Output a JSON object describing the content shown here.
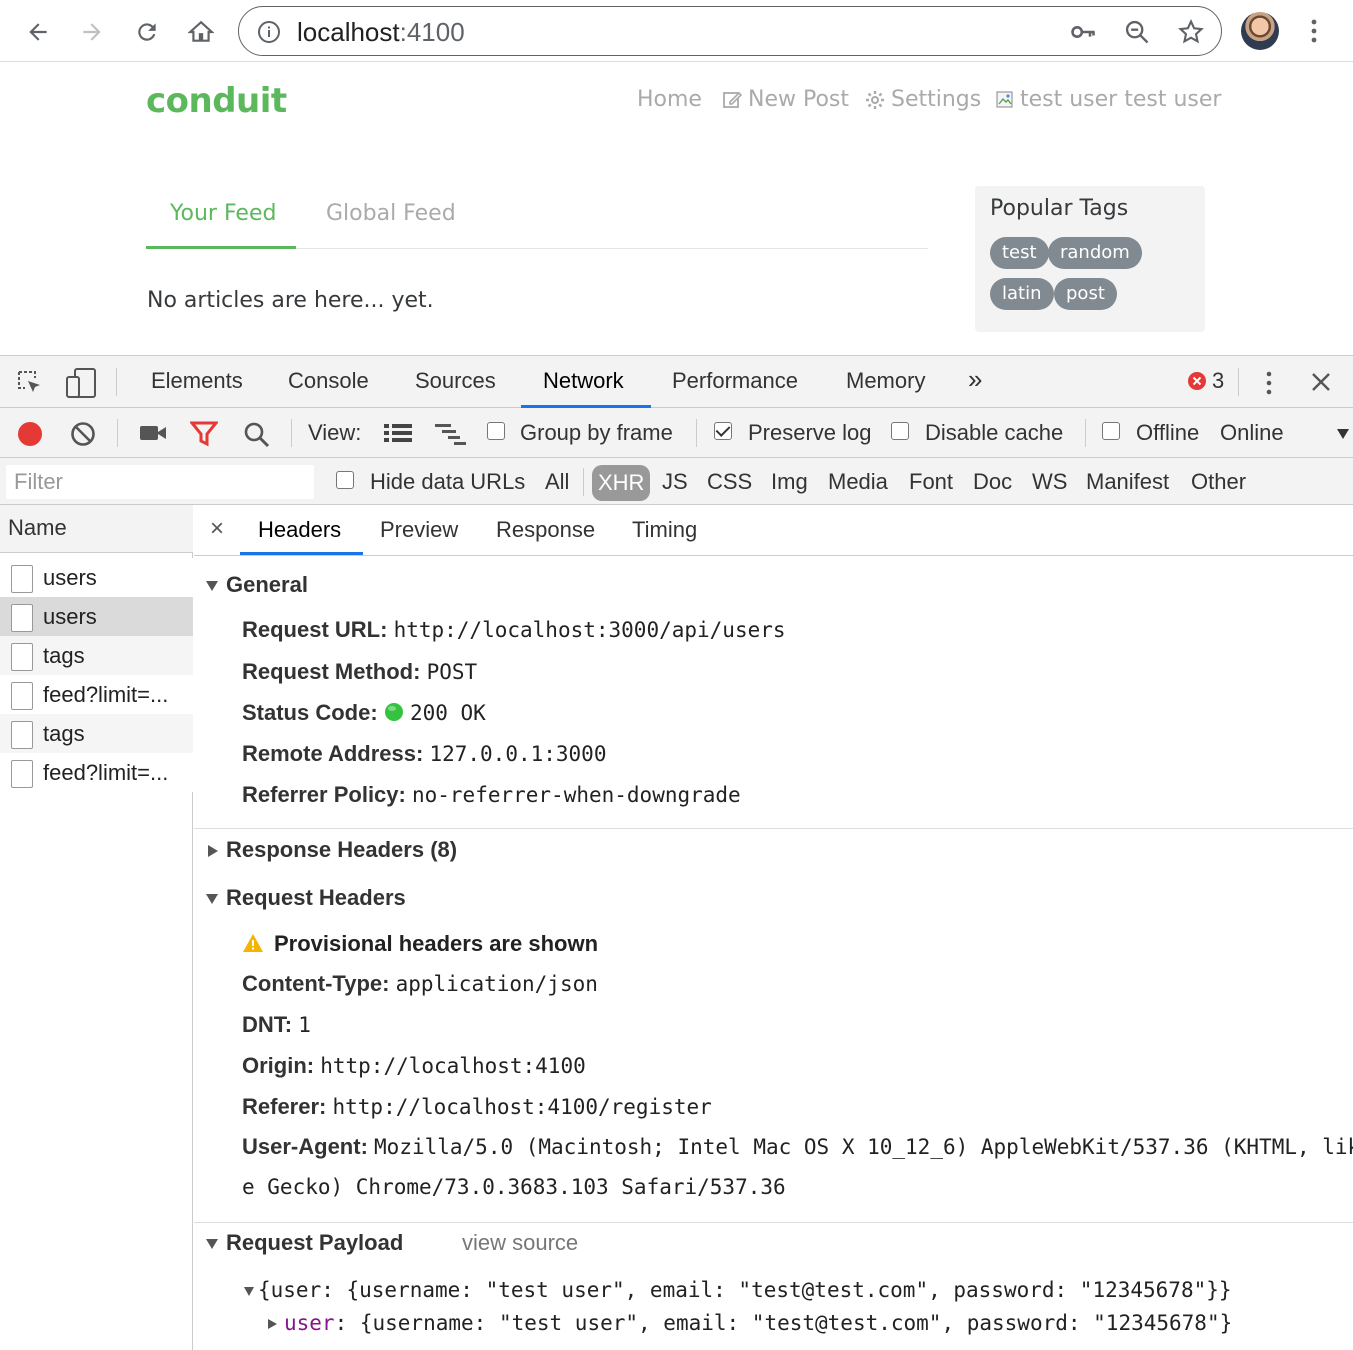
{
  "browser": {
    "url_host": "localhost",
    "url_port": ":4100"
  },
  "app": {
    "brand": "conduit",
    "nav": {
      "home": "Home",
      "new_post": "New Post",
      "settings": "Settings",
      "profile": "test user test user"
    },
    "feed_tabs": [
      "Your Feed",
      "Global Feed"
    ],
    "empty_message": "No articles are here... yet.",
    "popular_tags": {
      "title": "Popular Tags",
      "tags": [
        "test",
        "random",
        "latin",
        "post"
      ]
    }
  },
  "devtools": {
    "tabs": [
      "Elements",
      "Console",
      "Sources",
      "Network",
      "Performance",
      "Memory"
    ],
    "active_tab": "Network",
    "more_tabs": "»",
    "error_count": "3",
    "toolbar": {
      "view_label": "View:",
      "group_by_frame": "Group by frame",
      "preserve_log": "Preserve log",
      "disable_cache": "Disable cache",
      "offline": "Offline",
      "throttling": "Online"
    },
    "filter": {
      "placeholder": "Filter",
      "hide_data_urls": "Hide data URLs",
      "types": [
        "All",
        "XHR",
        "JS",
        "CSS",
        "Img",
        "Media",
        "Font",
        "Doc",
        "WS",
        "Manifest",
        "Other"
      ],
      "active_type": "XHR"
    },
    "requests": {
      "header": "Name",
      "items": [
        "users",
        "users",
        "tags",
        "feed?limit=...",
        "tags",
        "feed?limit=..."
      ]
    },
    "detail": {
      "close": "×",
      "tabs": [
        "Headers",
        "Preview",
        "Response",
        "Timing"
      ],
      "general": {
        "title": "General",
        "request_url_key": "Request URL:",
        "request_url": "http://localhost:3000/api/users",
        "method_key": "Request Method:",
        "method": "POST",
        "status_key": "Status Code:",
        "status": "200 OK",
        "remote_key": "Remote Address:",
        "remote": "127.0.0.1:3000",
        "referrer_key": "Referrer Policy:",
        "referrer": "no-referrer-when-downgrade"
      },
      "response_headers_title": "Response Headers (8)",
      "request_headers": {
        "title": "Request Headers",
        "warning": "Provisional headers are shown",
        "content_type_key": "Content-Type:",
        "content_type": "application/json",
        "dnt_key": "DNT:",
        "dnt": "1",
        "origin_key": "Origin:",
        "origin": "http://localhost:4100",
        "referer_key": "Referer:",
        "referer": "http://localhost:4100/register",
        "ua_key": "User-Agent:",
        "ua_line1": "Mozilla/5.0 (Macintosh; Intel Mac OS X 10_12_6) AppleWebKit/537.36 (KHTML, lik",
        "ua_line2": "e Gecko) Chrome/73.0.3683.103 Safari/537.36"
      },
      "payload": {
        "title": "Request Payload",
        "view_source": "view source",
        "root": "{user: {username: \"test user\", email: \"test@test.com\", password: \"12345678\"}}",
        "child_key": "user",
        "child_value": ": {username: \"test user\", email: \"test@test.com\", password: \"12345678\"}"
      }
    }
  },
  "colors": {
    "brand_green": "#5cb85c",
    "devtools_accent": "#1a73e8",
    "record_red": "#e53935",
    "status_green": "#34c240"
  }
}
